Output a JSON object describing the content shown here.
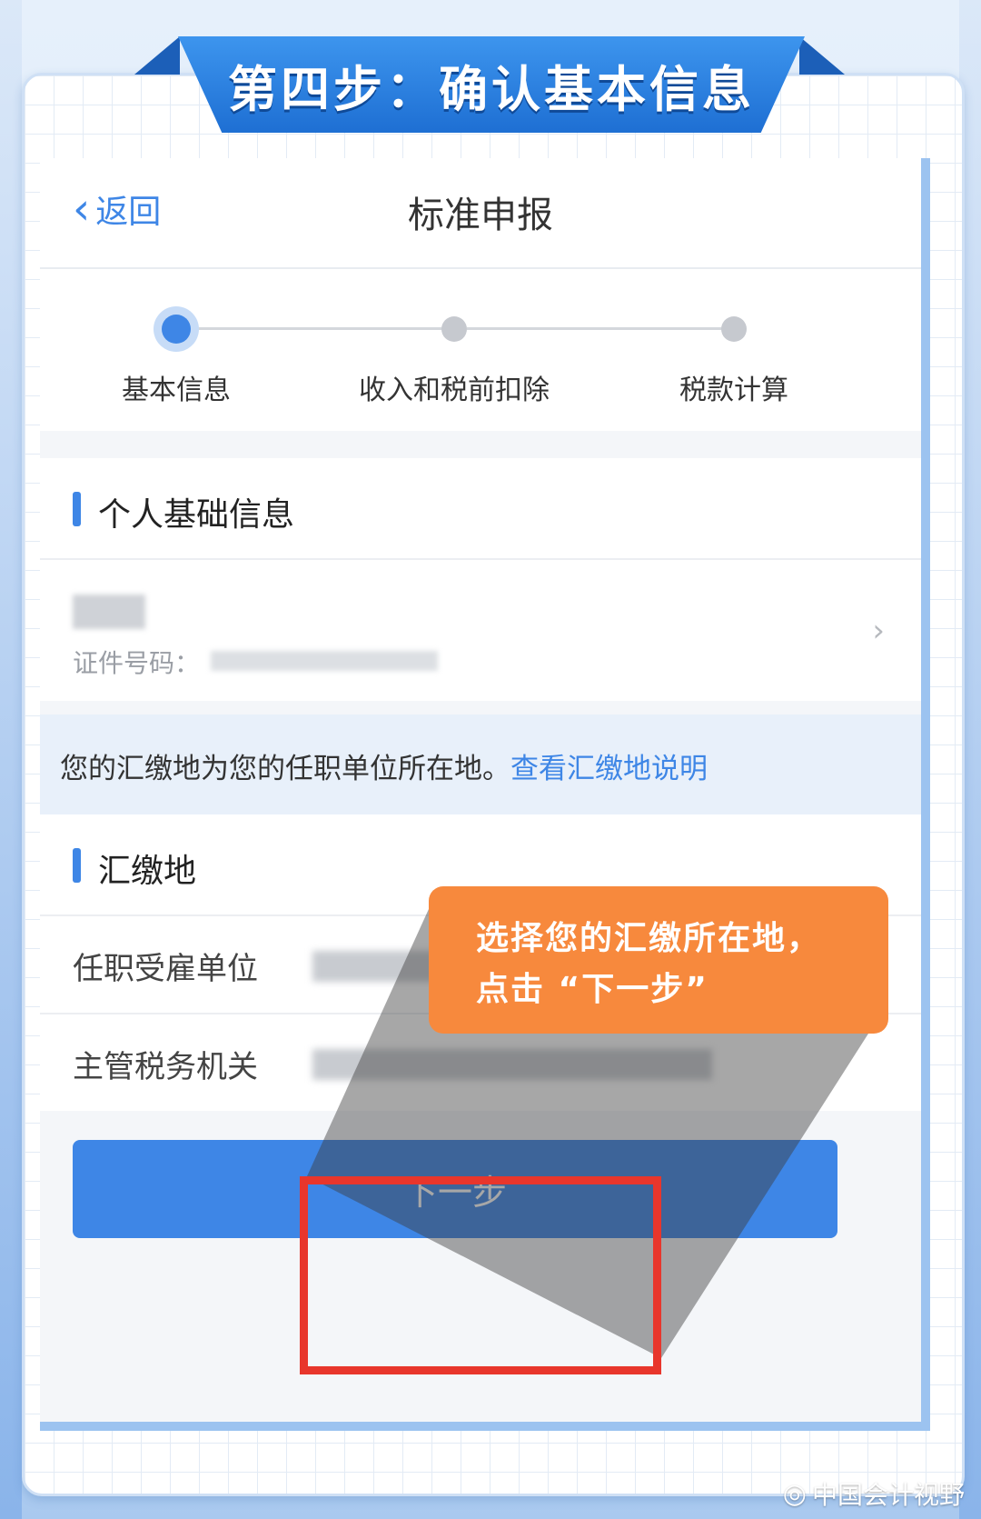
{
  "banner": {
    "title": "第四步：确认基本信息"
  },
  "nav": {
    "back_label": "返回",
    "title": "标准申报"
  },
  "steps": [
    {
      "label": "基本信息",
      "active": true
    },
    {
      "label": "收入和税前扣除",
      "active": false
    },
    {
      "label": "税款计算",
      "active": false
    }
  ],
  "personal_section": {
    "title": "个人基础信息",
    "id_label": "证件号码："
  },
  "notice": {
    "text": "您的汇缴地为您的任职单位所在地。",
    "link": "查看汇缴地说明"
  },
  "location_section": {
    "title": "汇缴地",
    "fields": [
      {
        "label": "任职受雇单位"
      },
      {
        "label": "主管税务机关"
      }
    ]
  },
  "next_button": {
    "label": "下一步"
  },
  "callout": {
    "line1": "选择您的汇缴所在地，",
    "line2": "点击 “下一步”"
  },
  "watermark": {
    "text": "中国会计视野"
  },
  "colors": {
    "primary": "#3e86e6",
    "banner": "#1e6fd3",
    "callout": "#f7893d",
    "highlight": "#e8362c"
  }
}
